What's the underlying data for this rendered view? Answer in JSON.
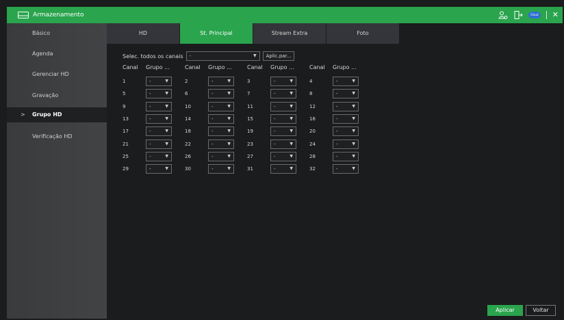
{
  "window": {
    "title": "Armazenamento",
    "icons": [
      "hdd-icon",
      "user-settings-icon",
      "logout-icon",
      "cloud-icon",
      "close-icon"
    ],
    "cloud_badge": "Cloud"
  },
  "sidebar": {
    "items": [
      {
        "label": "Básico"
      },
      {
        "label": "Agenda"
      },
      {
        "label": "Gerenciar HD"
      },
      {
        "label": "Gravação"
      },
      {
        "label": "Grupo HD",
        "active": true
      },
      {
        "label": "Verificação HD"
      }
    ],
    "chevron": ">"
  },
  "tabs": [
    {
      "label": "HD"
    },
    {
      "label": "St. Principal",
      "active": true
    },
    {
      "label": "Stream Extra"
    },
    {
      "label": "Foto"
    }
  ],
  "select_all": {
    "label": "Selec. todos os canais",
    "value": "-",
    "apply_label": "Aplic.par..."
  },
  "columns": {
    "canal": "Canal",
    "grupo": "Grupo ..."
  },
  "rows": [
    [
      {
        "ch": "1",
        "group": "-"
      },
      {
        "ch": "2",
        "group": "-"
      },
      {
        "ch": "3",
        "group": "-"
      },
      {
        "ch": "4",
        "group": "-"
      }
    ],
    [
      {
        "ch": "5",
        "group": "-"
      },
      {
        "ch": "6",
        "group": "-"
      },
      {
        "ch": "7",
        "group": "-"
      },
      {
        "ch": "8",
        "group": "-"
      }
    ],
    [
      {
        "ch": "9",
        "group": "-"
      },
      {
        "ch": "10",
        "group": "-"
      },
      {
        "ch": "11",
        "group": "-"
      },
      {
        "ch": "12",
        "group": "-"
      }
    ],
    [
      {
        "ch": "13",
        "group": "-"
      },
      {
        "ch": "14",
        "group": "-"
      },
      {
        "ch": "15",
        "group": "-"
      },
      {
        "ch": "16",
        "group": "-"
      }
    ],
    [
      {
        "ch": "17",
        "group": "-"
      },
      {
        "ch": "18",
        "group": "-"
      },
      {
        "ch": "19",
        "group": "-"
      },
      {
        "ch": "20",
        "group": "-"
      }
    ],
    [
      {
        "ch": "21",
        "group": "-"
      },
      {
        "ch": "22",
        "group": "-"
      },
      {
        "ch": "23",
        "group": "-"
      },
      {
        "ch": "24",
        "group": "-"
      }
    ],
    [
      {
        "ch": "25",
        "group": "-"
      },
      {
        "ch": "26",
        "group": "-"
      },
      {
        "ch": "27",
        "group": "-"
      },
      {
        "ch": "28",
        "group": "-"
      }
    ],
    [
      {
        "ch": "29",
        "group": "-"
      },
      {
        "ch": "30",
        "group": "-"
      },
      {
        "ch": "31",
        "group": "-"
      },
      {
        "ch": "32",
        "group": "-"
      }
    ]
  ],
  "footer": {
    "apply_label": "Aplicar",
    "back_label": "Voltar"
  },
  "colors": {
    "accent": "#2aa44d",
    "background": "#1b1c1e",
    "sidebar": "#3e3f41"
  }
}
